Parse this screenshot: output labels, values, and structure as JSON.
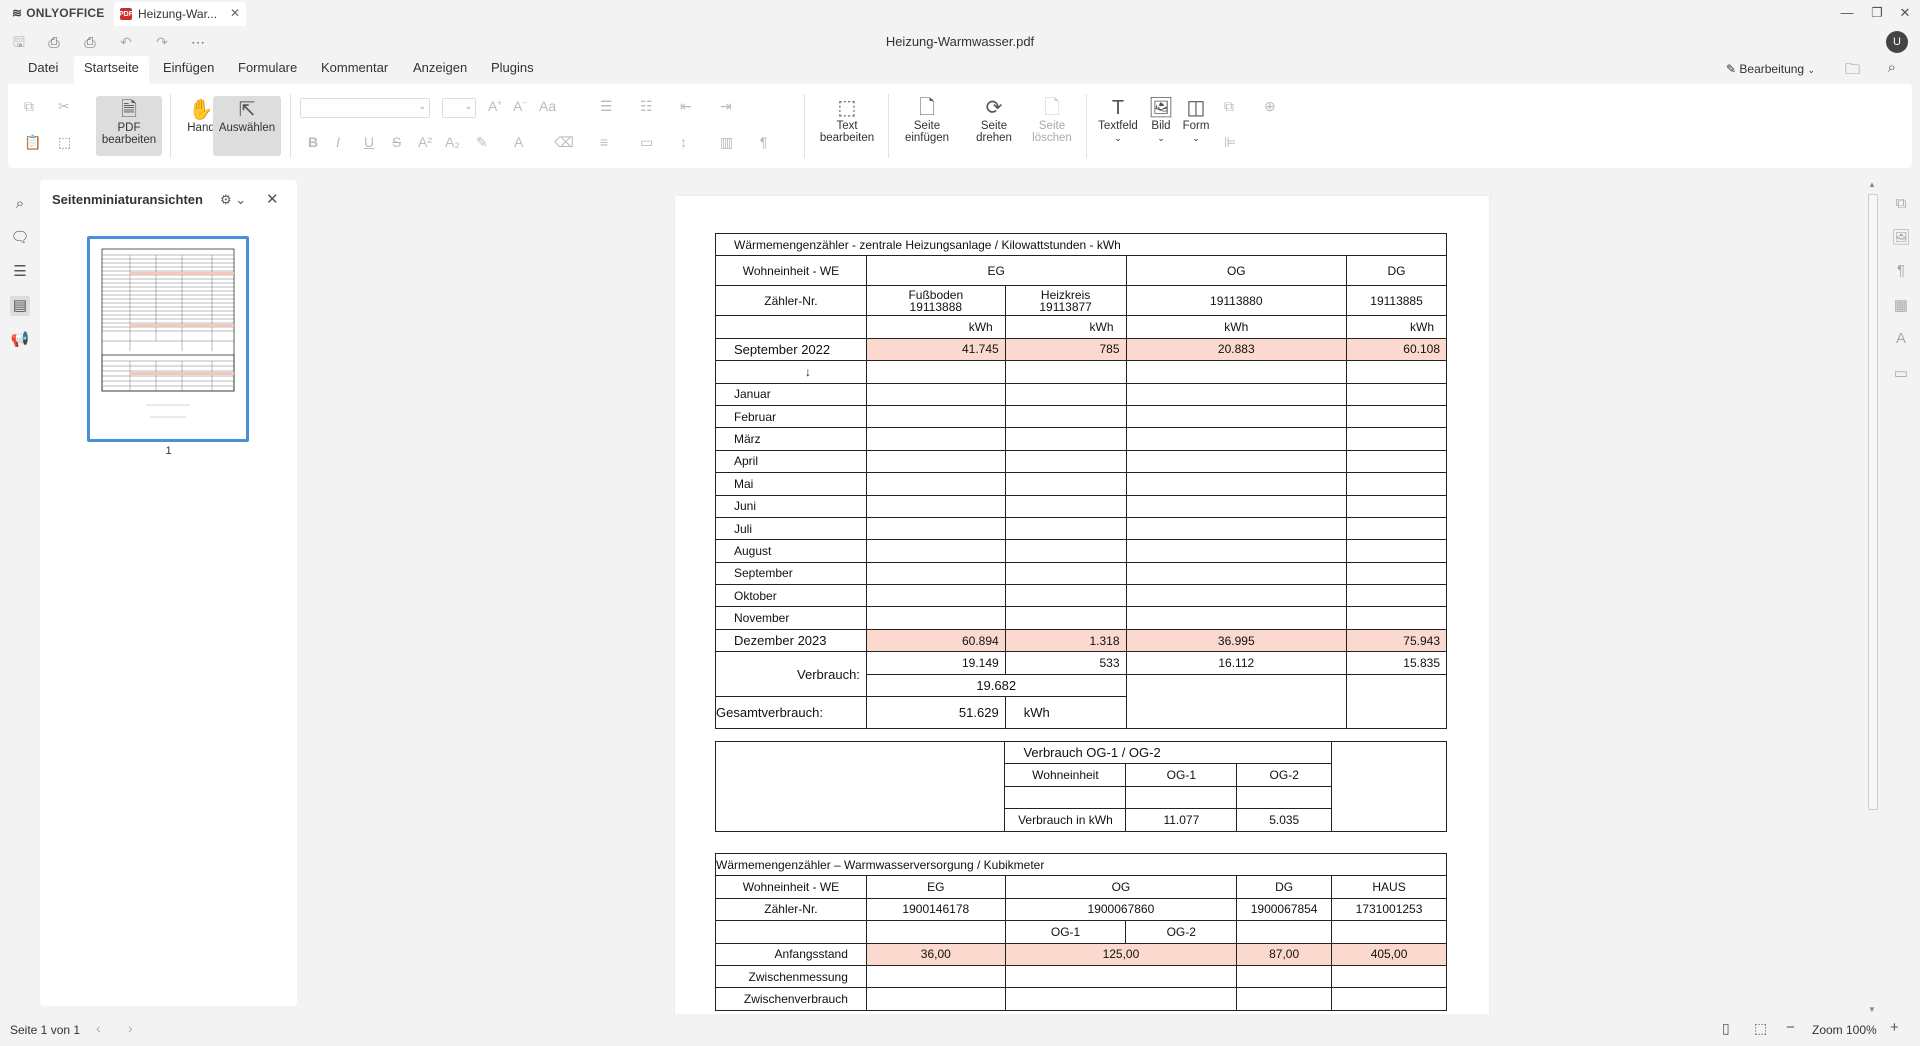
{
  "titlebar": {
    "app_name": "ONLYOFFICE",
    "tab_label": "Heizung-War...",
    "tab_badge": "PDF"
  },
  "quick": {
    "doc_title": "Heizung-Warmwasser.pdf",
    "avatar": "U"
  },
  "menu": {
    "tabs": [
      "Datei",
      "Startseite",
      "Einfügen",
      "Formulare",
      "Kommentar",
      "Anzeigen",
      "Plugins"
    ],
    "active": "Startseite",
    "edit_mode": "Bearbeitung"
  },
  "toolbar": {
    "pdf_edit": "PDF bearbeiten",
    "hand": "Hand",
    "select": "Auswählen",
    "text_edit": "Text bearbeiten",
    "insert_page": "Seite einfügen",
    "rotate_page": "Seite drehen",
    "delete_page": "Seite löschen",
    "textfield": "Textfeld",
    "image": "Bild",
    "form": "Form"
  },
  "thumbs": {
    "title": "Seitenminiaturansichten",
    "page_number": "1"
  },
  "heating": {
    "title": "Wärmemengenzähler - zentrale Heizungsanlage   /  Kilowattstunden - kWh",
    "we_label": "Wohneinheit - WE",
    "col_eg": "EG",
    "col_og": "OG",
    "col_dg": "DG",
    "meter_label": "Zähler-Nr.",
    "eg_floor": "Fußboden",
    "eg_floor_no": "19113888",
    "eg_circuit": "Heizkreis",
    "eg_circuit_no": "19113877",
    "og_no": "19113880",
    "dg_no": "19113885",
    "unit": "kWh",
    "start_label": "September 2022",
    "start_values": [
      "41.745",
      "785",
      "20.883",
      "60.108"
    ],
    "arrow": "↓",
    "months": [
      "Januar",
      "Februar",
      "März",
      "April",
      "Mai",
      "Juni",
      "Juli",
      "August",
      "September",
      "Oktober",
      "November"
    ],
    "end_label": "Dezember 2023",
    "end_values": [
      "60.894",
      "1.318",
      "36.995",
      "75.943"
    ],
    "consumption_label": "Verbrauch:",
    "consumption_values": [
      "19.149",
      "533",
      "16.112",
      "15.835"
    ],
    "eg_sum": "19.682",
    "total_label": "Gesamtverbrauch:",
    "total_value": "51.629",
    "total_unit": "kWh",
    "og_split_title": "Verbrauch OG-1 / OG-2",
    "og_split_we": "Wohneinheit",
    "og1": "OG-1",
    "og2": "OG-2",
    "og_split_label": "Verbrauch in kWh",
    "og1_value": "11.077",
    "og2_value": "5.035"
  },
  "water": {
    "title": "Wärmemengenzähler – Warmwasserversorgung   /   Kubikmeter",
    "we_label": "Wohneinheit - WE",
    "col_eg": "EG",
    "col_og": "OG",
    "col_dg": "DG",
    "col_haus": "HAUS",
    "meter_label": "Zähler-Nr.",
    "eg_no": "1900146178",
    "og_no": "1900067860",
    "dg_no": "1900067854",
    "haus_no": "1731001253",
    "og1": "OG-1",
    "og2": "OG-2",
    "start_label": "Anfangsstand",
    "start_eg": "36,00",
    "start_og": "125,00",
    "start_dg": "87,00",
    "start_haus": "405,00",
    "mid_label": "Zwischenmessung",
    "mid_consumption_label": "Zwischenverbrauch"
  },
  "status": {
    "page": "Seite 1 von 1",
    "zoom": "Zoom 100%"
  }
}
